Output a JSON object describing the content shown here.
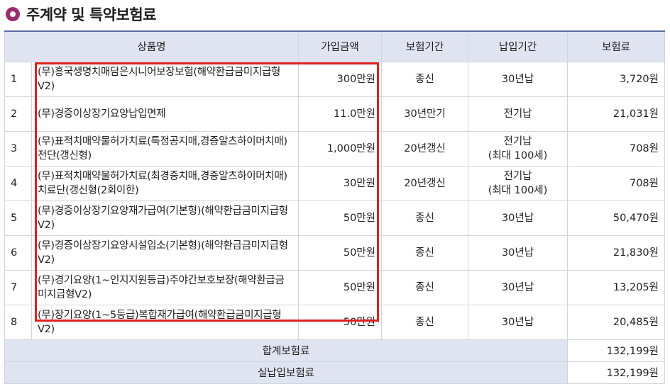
{
  "section": {
    "title": "주계약 및 특약보험료"
  },
  "table": {
    "headers": [
      "상품명",
      "가입금액",
      "보험기간",
      "납입기간",
      "보험료"
    ],
    "rows": [
      {
        "no": "1",
        "name": "(무)흥국생명치매담은시니어보장보험(해약환급금미지급형V2)",
        "amount": "300만원",
        "period": "종신",
        "payment": "30년납",
        "premium": "3,720원"
      },
      {
        "no": "2",
        "name": "(무)경증이상장기요양납입면제",
        "amount": "11.0만원",
        "period": "30년만기",
        "payment": "전기납",
        "premium": "21,031원"
      },
      {
        "no": "3",
        "name": "(무)표적치매약물허가치료(특정공지매,경증알츠하이머치매)전단(갱신형)",
        "amount": "1,000만원",
        "period": "20년갱신",
        "payment": "전기납\n(최대 100세)",
        "premium": "708원"
      },
      {
        "no": "4",
        "name": "(무)표적치매약물허가치료(최경증치매,경증알츠하이머치매)치료단(갱신형(2회이한)",
        "amount": "30만원",
        "period": "20년갱신",
        "payment": "전기납\n(최대 100세)",
        "premium": "708원"
      },
      {
        "no": "5",
        "name": "(무)경증이상장기요양재가급여(기본형)(해약환급금미지급형V2)",
        "amount": "50만원",
        "period": "종신",
        "payment": "30년납",
        "premium": "50,470원"
      },
      {
        "no": "6",
        "name": "(무)경증이상장기요양시설입소(기본형)(해약환급금미지급형V2)",
        "amount": "50만원",
        "period": "종신",
        "payment": "30년납",
        "premium": "21,830원"
      },
      {
        "no": "7",
        "name": "(무)경기요양(1~인지지원등급)주야간보호보장(해약환급금미지급형V2)",
        "amount": "50만원",
        "period": "종신",
        "payment": "30년납",
        "premium": "13,205원"
      },
      {
        "no": "8",
        "name": "(무)장기요양(1~5등급)복합재가급여(해약환급금미지급형V2)",
        "amount": "50만원",
        "period": "종신",
        "payment": "30년납",
        "premium": "20,485원"
      }
    ],
    "total_label": "합계보험료",
    "total_value": "132,199원",
    "paid_label": "실납입보험료",
    "paid_value": "132,199원"
  },
  "colors": {
    "header_bg": "#dfe4f0",
    "bullet": "#9b2f6e",
    "highlight": "#e02020"
  }
}
